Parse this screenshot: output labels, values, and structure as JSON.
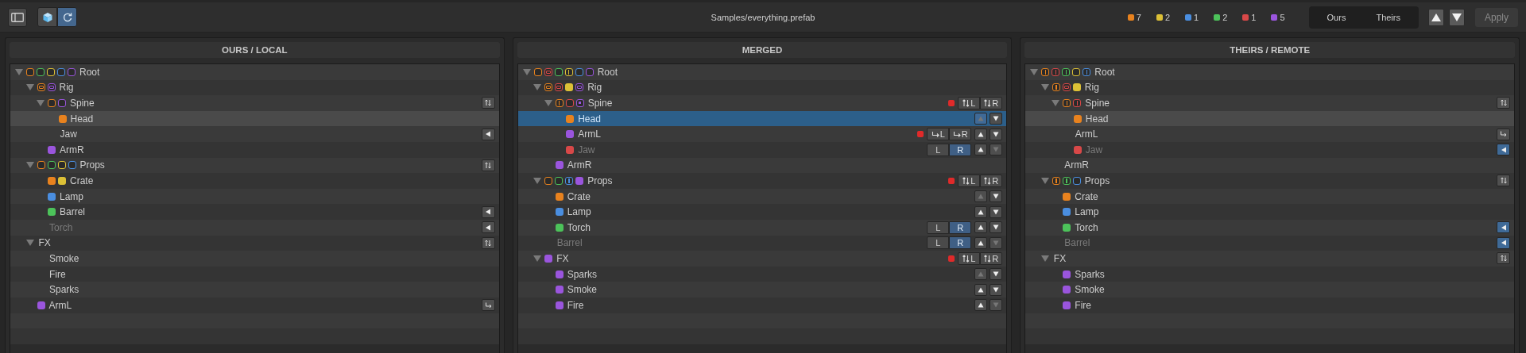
{
  "toolbar": {
    "view_modes": [
      {
        "kind": "cube",
        "selected": false
      },
      {
        "kind": "refresh",
        "selected": true
      }
    ],
    "title": "Samples/everything.prefab",
    "counts": [
      {
        "color": "#e8821e",
        "count": "7"
      },
      {
        "color": "#dcc036",
        "count": "2"
      },
      {
        "color": "#4a8ee0",
        "count": "1"
      },
      {
        "color": "#4cc25a",
        "count": "2"
      },
      {
        "color": "#d84848",
        "count": "1"
      },
      {
        "color": "#9a55dd",
        "count": "5"
      }
    ],
    "sides": [
      {
        "label": "Ours",
        "selected": false
      },
      {
        "label": "Theirs",
        "selected": false
      }
    ],
    "apply": {
      "label": "Apply",
      "disabled": true
    }
  },
  "panels": [
    {
      "title": "OURS / LOCAL",
      "focused": false,
      "rows": [
        {
          "label": "Root",
          "expanded": true,
          "selected": false,
          "dimmed": false,
          "markers": [
            {
              "color": "#e8821e",
              "kind": "outline"
            },
            {
              "color": "#4cc25a",
              "kind": "outline"
            },
            {
              "color": "#dcc036",
              "kind": "outline"
            },
            {
              "color": "#4a8ee0",
              "kind": "outline"
            },
            {
              "color": "#9a55dd",
              "kind": "outline"
            }
          ],
          "children": [
            {
              "label": "Rig",
              "expanded": true,
              "selected": false,
              "dimmed": false,
              "markers": [
                {
                  "color": "#e8821e",
                  "kind": "inset"
                },
                {
                  "color": "#9a55dd",
                  "kind": "inset"
                }
              ],
              "children": [
                {
                  "label": "Spine",
                  "expanded": true,
                  "selected": false,
                  "dimmed": false,
                  "markers": [
                    {
                      "color": "#e8821e",
                      "kind": "outline"
                    },
                    {
                      "color": "#9a55dd",
                      "kind": "outline"
                    }
                  ],
                  "actions": [
                    {
                      "kind": "swap",
                      "selected": false
                    }
                  ],
                  "children": [
                    {
                      "label": "Head",
                      "selected": true,
                      "dimmed": false,
                      "markers": [
                        {
                          "color": "#e8821e",
                          "kind": "filled"
                        }
                      ]
                    },
                    {
                      "label": "Jaw",
                      "selected": false,
                      "dimmed": false,
                      "actions": [
                        {
                          "kind": "take",
                          "selected": false
                        }
                      ]
                    }
                  ]
                },
                {
                  "label": "ArmR",
                  "selected": false,
                  "dimmed": false,
                  "markers": [
                    {
                      "color": "#9a55dd",
                      "kind": "filled"
                    }
                  ]
                }
              ]
            },
            {
              "label": "Props",
              "expanded": true,
              "selected": false,
              "dimmed": false,
              "markers": [
                {
                  "color": "#e8821e",
                  "kind": "outline"
                },
                {
                  "color": "#4cc25a",
                  "kind": "outline"
                },
                {
                  "color": "#dcc036",
                  "kind": "outline"
                },
                {
                  "color": "#4a8ee0",
                  "kind": "outline"
                }
              ],
              "actions": [
                {
                  "kind": "swap",
                  "selected": false
                }
              ],
              "children": [
                {
                  "label": "Crate",
                  "selected": false,
                  "dimmed": false,
                  "markers": [
                    {
                      "color": "#e8821e",
                      "kind": "filled"
                    },
                    {
                      "color": "#dcc036",
                      "kind": "filled"
                    }
                  ]
                },
                {
                  "label": "Lamp",
                  "selected": false,
                  "dimmed": false,
                  "markers": [
                    {
                      "color": "#4a8ee0",
                      "kind": "filled"
                    }
                  ]
                },
                {
                  "label": "Barrel",
                  "selected": false,
                  "dimmed": false,
                  "markers": [
                    {
                      "color": "#4cc25a",
                      "kind": "filled"
                    }
                  ],
                  "actions": [
                    {
                      "kind": "take",
                      "selected": false
                    }
                  ]
                },
                {
                  "label": "Torch",
                  "selected": false,
                  "dimmed": true,
                  "actions": [
                    {
                      "kind": "take",
                      "selected": false
                    }
                  ]
                }
              ]
            },
            {
              "label": "FX",
              "expanded": true,
              "selected": false,
              "dimmed": false,
              "actions": [
                {
                  "kind": "swap",
                  "selected": false
                }
              ],
              "children": [
                {
                  "label": "Smoke",
                  "selected": false,
                  "dimmed": false
                },
                {
                  "label": "Fire",
                  "selected": false,
                  "dimmed": false
                },
                {
                  "label": "Sparks",
                  "selected": false,
                  "dimmed": false
                }
              ]
            },
            {
              "label": "ArmL",
              "selected": false,
              "dimmed": false,
              "markers": [
                {
                  "color": "#9a55dd",
                  "kind": "filled"
                }
              ],
              "actions": [
                {
                  "kind": "return",
                  "selected": false
                }
              ]
            }
          ]
        }
      ]
    },
    {
      "title": "MERGED",
      "focused": true,
      "rows": [
        {
          "label": "Root",
          "expanded": true,
          "selected": false,
          "dimmed": false,
          "markers": [
            {
              "color": "#e8821e",
              "kind": "outline"
            },
            {
              "color": "#d84848",
              "kind": "inset"
            },
            {
              "color": "#4cc25a",
              "kind": "outline"
            },
            {
              "color": "#dcc036",
              "kind": "split"
            },
            {
              "color": "#4a8ee0",
              "kind": "outline"
            },
            {
              "color": "#9a55dd",
              "kind": "outline"
            }
          ],
          "children": [
            {
              "label": "Rig",
              "expanded": true,
              "selected": false,
              "dimmed": false,
              "markers": [
                {
                  "color": "#e8821e",
                  "kind": "inset"
                },
                {
                  "color": "#d84848",
                  "kind": "inset"
                },
                {
                  "color": "#dcc036",
                  "kind": "filled"
                },
                {
                  "color": "#9a55dd",
                  "kind": "inset"
                }
              ],
              "children": [
                {
                  "label": "Spine",
                  "expanded": true,
                  "selected": false,
                  "dimmed": false,
                  "markers": [
                    {
                      "color": "#e8821e",
                      "kind": "split"
                    },
                    {
                      "color": "#d84848",
                      "kind": "outline"
                    },
                    {
                      "color": "#9a55dd",
                      "kind": "dot"
                    }
                  ],
                  "actions": [
                    {
                      "kind": "conflict"
                    },
                    {
                      "kind": "swap-pair",
                      "labels": [
                        "L",
                        "R"
                      ]
                    }
                  ],
                  "children": [
                    {
                      "label": "Head",
                      "selected": true,
                      "dimmed": false,
                      "markers": [
                        {
                          "color": "#e8821e",
                          "kind": "filled"
                        }
                      ],
                      "actions": [
                        {
                          "kind": "order",
                          "up_disabled": true,
                          "down_disabled": false
                        }
                      ]
                    },
                    {
                      "label": "ArmL",
                      "selected": false,
                      "dimmed": false,
                      "markers": [
                        {
                          "color": "#9a55dd",
                          "kind": "filled"
                        }
                      ],
                      "actions": [
                        {
                          "kind": "conflict"
                        },
                        {
                          "kind": "move-pair",
                          "labels": [
                            "L",
                            "R"
                          ]
                        },
                        {
                          "kind": "order",
                          "up_disabled": false,
                          "down_disabled": false
                        }
                      ]
                    },
                    {
                      "label": "Jaw",
                      "selected": false,
                      "dimmed": true,
                      "markers": [
                        {
                          "color": "#d84848",
                          "kind": "filled"
                        }
                      ],
                      "actions": [
                        {
                          "kind": "pick",
                          "options": [
                            {
                              "label": "L",
                              "selected": false
                            },
                            {
                              "label": "R",
                              "selected": true
                            }
                          ]
                        },
                        {
                          "kind": "order",
                          "up_disabled": false,
                          "down_disabled": true
                        }
                      ]
                    }
                  ]
                },
                {
                  "label": "ArmR",
                  "selected": false,
                  "dimmed": false,
                  "markers": [
                    {
                      "color": "#9a55dd",
                      "kind": "filled"
                    }
                  ]
                }
              ]
            },
            {
              "label": "Props",
              "expanded": true,
              "selected": false,
              "dimmed": false,
              "markers": [
                {
                  "color": "#e8821e",
                  "kind": "outline"
                },
                {
                  "color": "#4cc25a",
                  "kind": "outline"
                },
                {
                  "color": "#4a8ee0",
                  "kind": "split"
                },
                {
                  "color": "#9a55dd",
                  "kind": "filled"
                }
              ],
              "actions": [
                {
                  "kind": "conflict"
                },
                {
                  "kind": "swap-pair",
                  "labels": [
                    "L",
                    "R"
                  ]
                }
              ],
              "children": [
                {
                  "label": "Crate",
                  "selected": false,
                  "dimmed": false,
                  "markers": [
                    {
                      "color": "#e8821e",
                      "kind": "filled"
                    }
                  ],
                  "actions": [
                    {
                      "kind": "order",
                      "up_disabled": true,
                      "down_disabled": false
                    }
                  ]
                },
                {
                  "label": "Lamp",
                  "selected": false,
                  "dimmed": false,
                  "markers": [
                    {
                      "color": "#4a8ee0",
                      "kind": "filled"
                    }
                  ],
                  "actions": [
                    {
                      "kind": "order",
                      "up_disabled": false,
                      "down_disabled": false
                    }
                  ]
                },
                {
                  "label": "Torch",
                  "selected": false,
                  "dimmed": false,
                  "markers": [
                    {
                      "color": "#4cc25a",
                      "kind": "filled"
                    }
                  ],
                  "actions": [
                    {
                      "kind": "pick",
                      "options": [
                        {
                          "label": "L",
                          "selected": false
                        },
                        {
                          "label": "R",
                          "selected": true
                        }
                      ]
                    },
                    {
                      "kind": "order",
                      "up_disabled": false,
                      "down_disabled": false
                    }
                  ]
                },
                {
                  "label": "Barrel",
                  "selected": false,
                  "dimmed": true,
                  "actions": [
                    {
                      "kind": "pick",
                      "options": [
                        {
                          "label": "L",
                          "selected": false
                        },
                        {
                          "label": "R",
                          "selected": true
                        }
                      ]
                    },
                    {
                      "kind": "order",
                      "up_disabled": false,
                      "down_disabled": true
                    }
                  ]
                }
              ]
            },
            {
              "label": "FX",
              "expanded": true,
              "selected": false,
              "dimmed": false,
              "markers": [
                {
                  "color": "#9a55dd",
                  "kind": "filled"
                }
              ],
              "actions": [
                {
                  "kind": "conflict"
                },
                {
                  "kind": "swap-pair",
                  "labels": [
                    "L",
                    "R"
                  ]
                }
              ],
              "children": [
                {
                  "label": "Sparks",
                  "selected": false,
                  "dimmed": false,
                  "markers": [
                    {
                      "color": "#9a55dd",
                      "kind": "filled"
                    }
                  ],
                  "actions": [
                    {
                      "kind": "order",
                      "up_disabled": true,
                      "down_disabled": false
                    }
                  ]
                },
                {
                  "label": "Smoke",
                  "selected": false,
                  "dimmed": false,
                  "markers": [
                    {
                      "color": "#9a55dd",
                      "kind": "filled"
                    }
                  ],
                  "actions": [
                    {
                      "kind": "order",
                      "up_disabled": false,
                      "down_disabled": false
                    }
                  ]
                },
                {
                  "label": "Fire",
                  "selected": false,
                  "dimmed": false,
                  "markers": [
                    {
                      "color": "#9a55dd",
                      "kind": "filled"
                    }
                  ],
                  "actions": [
                    {
                      "kind": "order",
                      "up_disabled": false,
                      "down_disabled": true
                    }
                  ]
                }
              ]
            }
          ]
        }
      ]
    },
    {
      "title": "THEIRS / REMOTE",
      "focused": false,
      "rows": [
        {
          "label": "Root",
          "expanded": true,
          "selected": false,
          "dimmed": false,
          "markers": [
            {
              "color": "#e8821e",
              "kind": "split"
            },
            {
              "color": "#d84848",
              "kind": "split"
            },
            {
              "color": "#4cc25a",
              "kind": "split"
            },
            {
              "color": "#dcc036",
              "kind": "outline"
            },
            {
              "color": "#4a8ee0",
              "kind": "split"
            }
          ],
          "children": [
            {
              "label": "Rig",
              "expanded": true,
              "selected": false,
              "dimmed": false,
              "markers": [
                {
                  "color": "#e8821e",
                  "kind": "split"
                },
                {
                  "color": "#d84848",
                  "kind": "inset"
                },
                {
                  "color": "#dcc036",
                  "kind": "filled"
                }
              ],
              "children": [
                {
                  "label": "Spine",
                  "expanded": true,
                  "selected": false,
                  "dimmed": false,
                  "markers": [
                    {
                      "color": "#e8821e",
                      "kind": "split"
                    },
                    {
                      "color": "#d84848",
                      "kind": "split"
                    }
                  ],
                  "actions": [
                    {
                      "kind": "swap",
                      "selected": false
                    }
                  ],
                  "children": [
                    {
                      "label": "Head",
                      "selected": true,
                      "dimmed": false,
                      "markers": [
                        {
                          "color": "#e8821e",
                          "kind": "filled"
                        }
                      ]
                    },
                    {
                      "label": "ArmL",
                      "selected": false,
                      "dimmed": false,
                      "actions": [
                        {
                          "kind": "return",
                          "selected": false
                        }
                      ]
                    },
                    {
                      "label": "Jaw",
                      "selected": false,
                      "dimmed": true,
                      "markers": [
                        {
                          "color": "#d84848",
                          "kind": "filled"
                        }
                      ],
                      "actions": [
                        {
                          "kind": "take",
                          "selected": true
                        }
                      ]
                    }
                  ]
                },
                {
                  "label": "ArmR",
                  "selected": false,
                  "dimmed": false
                }
              ]
            },
            {
              "label": "Props",
              "expanded": true,
              "selected": false,
              "dimmed": false,
              "markers": [
                {
                  "color": "#e8821e",
                  "kind": "split"
                },
                {
                  "color": "#4cc25a",
                  "kind": "split"
                },
                {
                  "color": "#4a8ee0",
                  "kind": "outline"
                }
              ],
              "actions": [
                {
                  "kind": "swap",
                  "selected": false
                }
              ],
              "children": [
                {
                  "label": "Crate",
                  "selected": false,
                  "dimmed": false,
                  "markers": [
                    {
                      "color": "#e8821e",
                      "kind": "filled"
                    }
                  ]
                },
                {
                  "label": "Lamp",
                  "selected": false,
                  "dimmed": false,
                  "markers": [
                    {
                      "color": "#4a8ee0",
                      "kind": "filled"
                    }
                  ]
                },
                {
                  "label": "Torch",
                  "selected": false,
                  "dimmed": false,
                  "markers": [
                    {
                      "color": "#4cc25a",
                      "kind": "filled"
                    }
                  ],
                  "actions": [
                    {
                      "kind": "take",
                      "selected": true
                    }
                  ]
                },
                {
                  "label": "Barrel",
                  "selected": false,
                  "dimmed": true,
                  "actions": [
                    {
                      "kind": "take",
                      "selected": true
                    }
                  ]
                }
              ]
            },
            {
              "label": "FX",
              "expanded": true,
              "selected": false,
              "dimmed": false,
              "actions": [
                {
                  "kind": "swap",
                  "selected": false
                }
              ],
              "children": [
                {
                  "label": "Sparks",
                  "selected": false,
                  "dimmed": false,
                  "markers": [
                    {
                      "color": "#9a55dd",
                      "kind": "filled"
                    }
                  ]
                },
                {
                  "label": "Smoke",
                  "selected": false,
                  "dimmed": false,
                  "markers": [
                    {
                      "color": "#9a55dd",
                      "kind": "filled"
                    }
                  ]
                },
                {
                  "label": "Fire",
                  "selected": false,
                  "dimmed": false,
                  "markers": [
                    {
                      "color": "#9a55dd",
                      "kind": "filled"
                    }
                  ]
                }
              ]
            }
          ]
        }
      ]
    }
  ]
}
